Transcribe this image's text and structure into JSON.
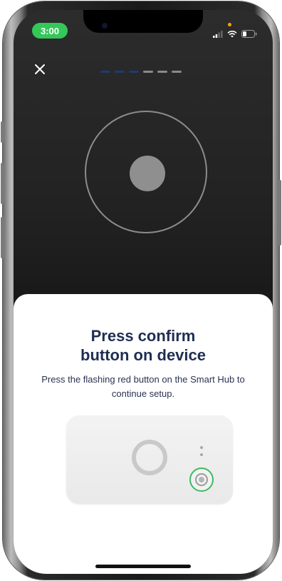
{
  "status_bar": {
    "time": "3:00",
    "time_pill_color": "#34c759",
    "icons": [
      "cellular-signal-icon",
      "wifi-icon",
      "battery-icon"
    ]
  },
  "nav": {
    "close_icon": "close-icon",
    "progress": {
      "total_steps": 6,
      "completed_steps": 3,
      "active_color": "#1f3b73",
      "inactive_color": "#8a8a8a"
    }
  },
  "sheet": {
    "title_line1": "Press confirm",
    "title_line2": "button on device",
    "subtitle": "Press the flashing red button on the Smart Hub to continue setup.",
    "title_color": "#1f2f52"
  },
  "device_illustration": {
    "highlight_color": "#3dbb5f"
  }
}
